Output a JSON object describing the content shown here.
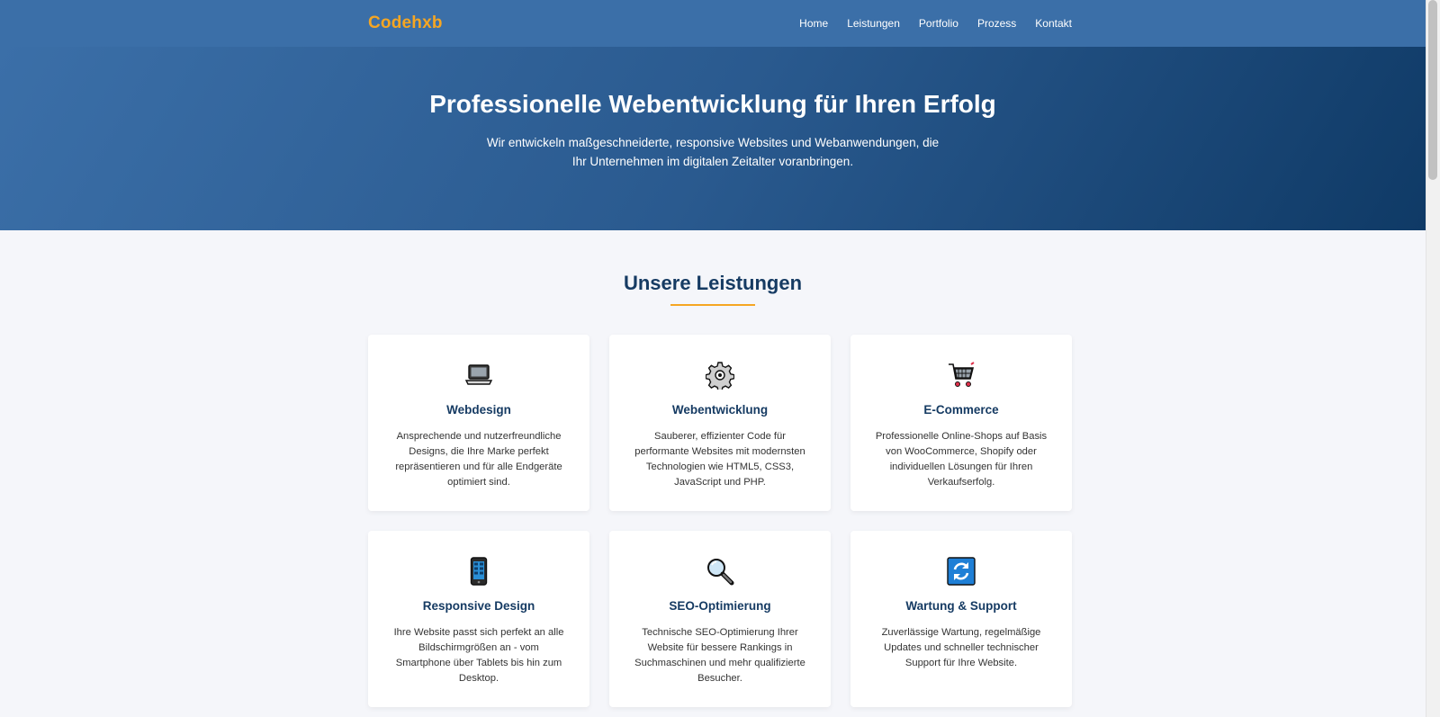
{
  "nav": {
    "logo": "Codehxb",
    "links": [
      "Home",
      "Leistungen",
      "Portfolio",
      "Prozess",
      "Kontakt"
    ]
  },
  "hero": {
    "title": "Professionelle Webentwicklung für Ihren Erfolg",
    "subtitle": "Wir entwickeln maßgeschneiderte, responsive Websites und Webanwendungen, die Ihr Unternehmen im digitalen Zeitalter voranbringen."
  },
  "services": {
    "title": "Unsere Leistungen",
    "items": [
      {
        "icon": "laptop-icon",
        "title": "Webdesign",
        "text": "Ansprechende und nutzerfreundliche Designs, die Ihre Marke perfekt repräsentieren und für alle Endgeräte optimiert sind."
      },
      {
        "icon": "gear-icon",
        "title": "Webentwicklung",
        "text": "Sauberer, effizienter Code für performante Websites mit modernsten Technologien wie HTML5, CSS3, JavaScript und PHP."
      },
      {
        "icon": "shopping-cart-icon",
        "title": "E-Commerce",
        "text": "Professionelle Online-Shops auf Basis von WooCommerce, Shopify oder individuellen Lösungen für Ihren Verkaufserfolg."
      },
      {
        "icon": "mobile-phone-icon",
        "title": "Responsive Design",
        "text": "Ihre Website passt sich perfekt an alle Bildschirmgrößen an - vom Smartphone über Tablets bis hin zum Desktop."
      },
      {
        "icon": "magnifier-icon",
        "title": "SEO-Optimierung",
        "text": "Technische SEO-Optimierung Ihrer Website für bessere Rankings in Suchmaschinen und mehr qualifizierte Besucher."
      },
      {
        "icon": "refresh-icon",
        "title": "Wartung & Support",
        "text": "Zuverlässige Wartung, regelmäßige Updates und schneller technischer Support für Ihre Website."
      }
    ]
  },
  "colors": {
    "nav_bg": "#3b6fa8",
    "accent": "#f5a623",
    "heading": "#163b63",
    "hero_gradient_end": "#0f3a66"
  }
}
